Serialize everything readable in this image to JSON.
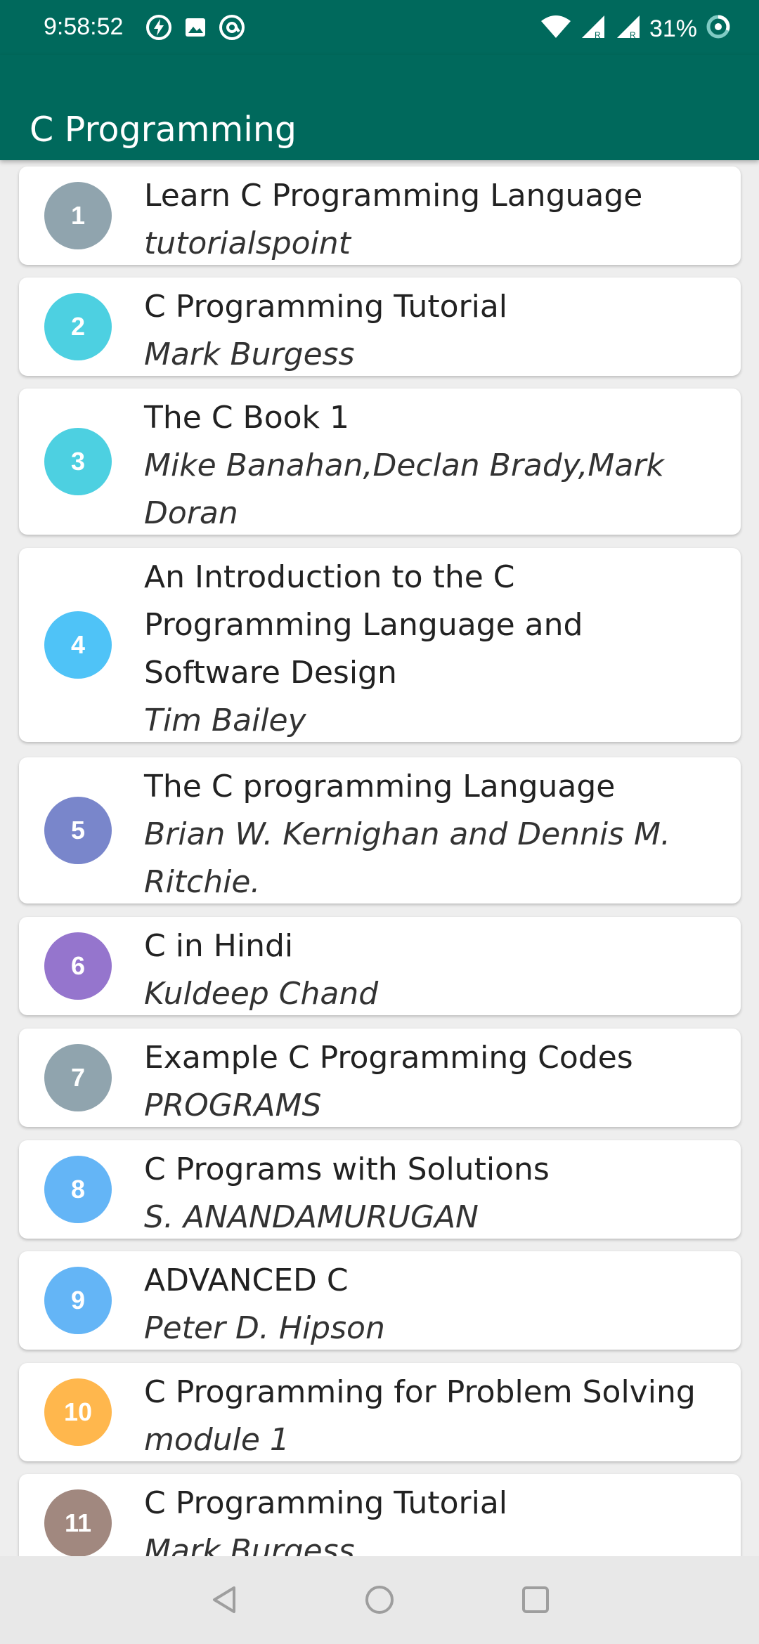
{
  "status_bar": {
    "time": "9:58:52",
    "battery": "31%",
    "icons": [
      "flash-circle-icon",
      "image-icon",
      "at-circle-icon",
      "wifi-icon",
      "signal-r-icon",
      "signal-r-icon",
      "battery-ring-icon"
    ]
  },
  "app_bar": {
    "title": "C Programming",
    "color": "#00695c"
  },
  "books": [
    {
      "num": "1",
      "title": "Learn C Programming Language",
      "author": "tutorialspoint",
      "color": "#90a4ae"
    },
    {
      "num": "2",
      "title": "C Programming Tutorial",
      "author": "Mark Burgess",
      "color": "#4dd0e1"
    },
    {
      "num": "3",
      "title": "The C Book 1",
      "author": "Mike Banahan,Declan Brady,Mark Doran",
      "color": "#4dd0e1"
    },
    {
      "num": "4",
      "title": "An Introduction to the C Programming Language and Software Design",
      "author": "Tim Bailey",
      "color": "#4fc3f7"
    },
    {
      "num": "5",
      "title": "The C programming Language",
      "author": "Brian W. Kernighan and Dennis M. Ritchie.",
      "color": "#7986cb"
    },
    {
      "num": "6",
      "title": "C in Hindi",
      "author": "Kuldeep Chand",
      "color": "#9575cd"
    },
    {
      "num": "7",
      "title": "Example C Programming Codes",
      "author": "PROGRAMS",
      "color": "#90a4ae"
    },
    {
      "num": "8",
      "title": "C Programs with Solutions",
      "author": "S. ANANDAMURUGAN",
      "color": "#64b5f6"
    },
    {
      "num": "9",
      "title": "ADVANCED C",
      "author": "Peter D. Hipson",
      "color": "#64b5f6"
    },
    {
      "num": "10",
      "title": "C Programming for Problem Solving",
      "author": "module 1",
      "color": "#ffb74d"
    },
    {
      "num": "11",
      "title": "C Programming Tutorial",
      "author": "Mark Burgess",
      "color": "#a1887f"
    }
  ],
  "nav": {
    "icons": [
      "back-icon",
      "home-icon",
      "recents-icon"
    ]
  }
}
